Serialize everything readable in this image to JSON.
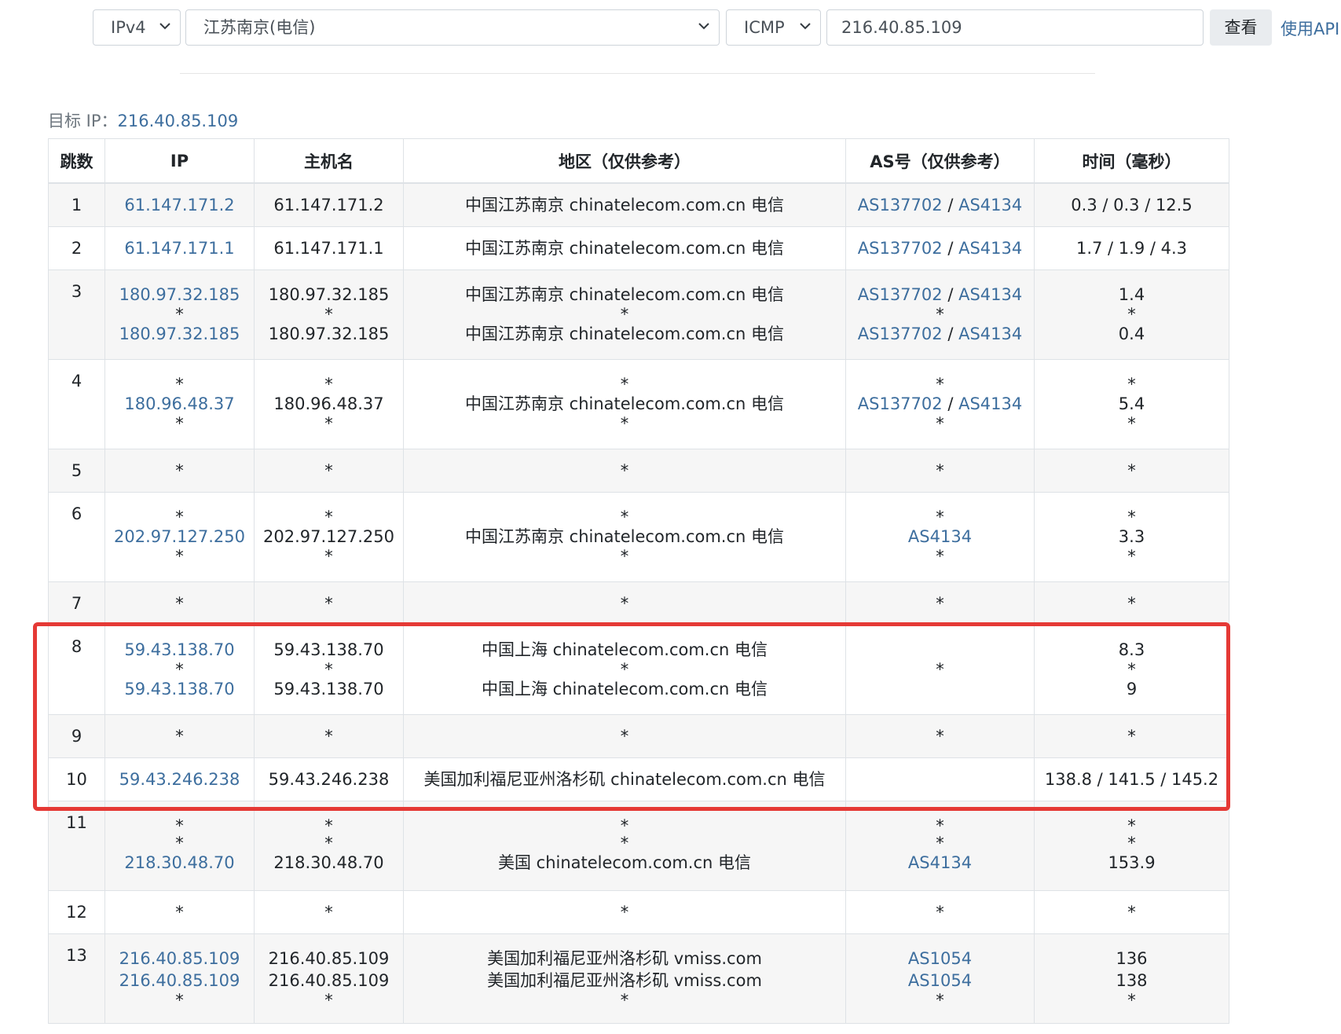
{
  "toolbar": {
    "ip_version": "IPv4",
    "location": "江苏南京(电信)",
    "protocol": "ICMP",
    "target_value": "216.40.85.109",
    "query_label": "查看",
    "api_link": "使用API"
  },
  "target": {
    "label": "目标 IP：",
    "value": "216.40.85.109"
  },
  "table": {
    "headers": [
      "跳数",
      "IP",
      "主机名",
      "地区（仅供参考）",
      "AS号（仅供参考）",
      "时间（毫秒）"
    ],
    "rows": [
      {
        "hop": "1",
        "ip": [
          "61.147.171.2"
        ],
        "host": [
          "61.147.171.2"
        ],
        "region": [
          "中国江苏南京 chinatelecom.com.cn 电信"
        ],
        "as": [
          [
            "AS137702",
            "AS4134"
          ]
        ],
        "time": [
          "0.3 / 0.3 / 12.5"
        ]
      },
      {
        "hop": "2",
        "ip": [
          "61.147.171.1"
        ],
        "host": [
          "61.147.171.1"
        ],
        "region": [
          "中国江苏南京 chinatelecom.com.cn 电信"
        ],
        "as": [
          [
            "AS137702",
            "AS4134"
          ]
        ],
        "time": [
          "1.7 / 1.9 / 4.3"
        ]
      },
      {
        "hop": "3",
        "ip": [
          "180.97.32.185",
          "*",
          "180.97.32.185"
        ],
        "host": [
          "180.97.32.185",
          "*",
          "180.97.32.185"
        ],
        "region": [
          "中国江苏南京 chinatelecom.com.cn 电信",
          "*",
          "中国江苏南京 chinatelecom.com.cn 电信"
        ],
        "as": [
          [
            "AS137702",
            "AS4134"
          ],
          "*",
          [
            "AS137702",
            "AS4134"
          ]
        ],
        "time": [
          "1.4",
          "*",
          "0.4"
        ]
      },
      {
        "hop": "4",
        "ip": [
          "*",
          "180.96.48.37",
          "*"
        ],
        "host": [
          "*",
          "180.96.48.37",
          "*"
        ],
        "region": [
          "*",
          "中国江苏南京 chinatelecom.com.cn 电信",
          "*"
        ],
        "as": [
          "*",
          [
            "AS137702",
            "AS4134"
          ],
          "*"
        ],
        "time": [
          "*",
          "5.4",
          "*"
        ]
      },
      {
        "hop": "5",
        "ip": [
          "*"
        ],
        "host": [
          "*"
        ],
        "region": [
          "*"
        ],
        "as": [
          "*"
        ],
        "time": [
          "*"
        ]
      },
      {
        "hop": "6",
        "ip": [
          "*",
          "202.97.127.250",
          "*"
        ],
        "host": [
          "*",
          "202.97.127.250",
          "*"
        ],
        "region": [
          "*",
          "中国江苏南京 chinatelecom.com.cn 电信",
          "*"
        ],
        "as": [
          "*",
          [
            "AS4134"
          ],
          "*"
        ],
        "time": [
          "*",
          "3.3",
          "*"
        ]
      },
      {
        "hop": "7",
        "ip": [
          "*"
        ],
        "host": [
          "*"
        ],
        "region": [
          "*"
        ],
        "as": [
          "*"
        ],
        "time": [
          "*"
        ]
      },
      {
        "hop": "8",
        "ip": [
          "59.43.138.70",
          "*",
          "59.43.138.70"
        ],
        "host": [
          "59.43.138.70",
          "*",
          "59.43.138.70"
        ],
        "region": [
          "中国上海 chinatelecom.com.cn 电信",
          "*",
          "中国上海 chinatelecom.com.cn 电信"
        ],
        "as": [
          "*"
        ],
        "time": [
          "8.3",
          "*",
          "9"
        ]
      },
      {
        "hop": "9",
        "ip": [
          "*"
        ],
        "host": [
          "*"
        ],
        "region": [
          "*"
        ],
        "as": [
          "*"
        ],
        "time": [
          "*"
        ]
      },
      {
        "hop": "10",
        "ip": [
          "59.43.246.238"
        ],
        "host": [
          "59.43.246.238"
        ],
        "region": [
          "美国加利福尼亚州洛杉矶 chinatelecom.com.cn 电信"
        ],
        "as": [],
        "time": [
          "138.8 / 141.5 / 145.2"
        ]
      },
      {
        "hop": "11",
        "ip": [
          "*",
          "*",
          "218.30.48.70"
        ],
        "host": [
          "*",
          "*",
          "218.30.48.70"
        ],
        "region": [
          "*",
          "*",
          "美国 chinatelecom.com.cn 电信"
        ],
        "as": [
          "*",
          "*",
          [
            "AS4134"
          ]
        ],
        "time": [
          "*",
          "*",
          "153.9"
        ]
      },
      {
        "hop": "12",
        "ip": [
          "*"
        ],
        "host": [
          "*"
        ],
        "region": [
          "*"
        ],
        "as": [
          "*"
        ],
        "time": [
          "*"
        ]
      },
      {
        "hop": "13",
        "ip": [
          "216.40.85.109",
          "216.40.85.109",
          "*"
        ],
        "host": [
          "216.40.85.109",
          "216.40.85.109",
          "*"
        ],
        "region": [
          "美国加利福尼亚州洛杉矶 vmiss.com",
          "美国加利福尼亚州洛杉矶 vmiss.com",
          "*"
        ],
        "as": [
          [
            "AS1054"
          ],
          [
            "AS1054"
          ],
          "*"
        ],
        "time": [
          "136",
          "138",
          "*"
        ]
      }
    ]
  },
  "colors": {
    "link": "#3d6e9e",
    "highlight_border": "#e53935",
    "stripe": "#f6f6f6"
  }
}
